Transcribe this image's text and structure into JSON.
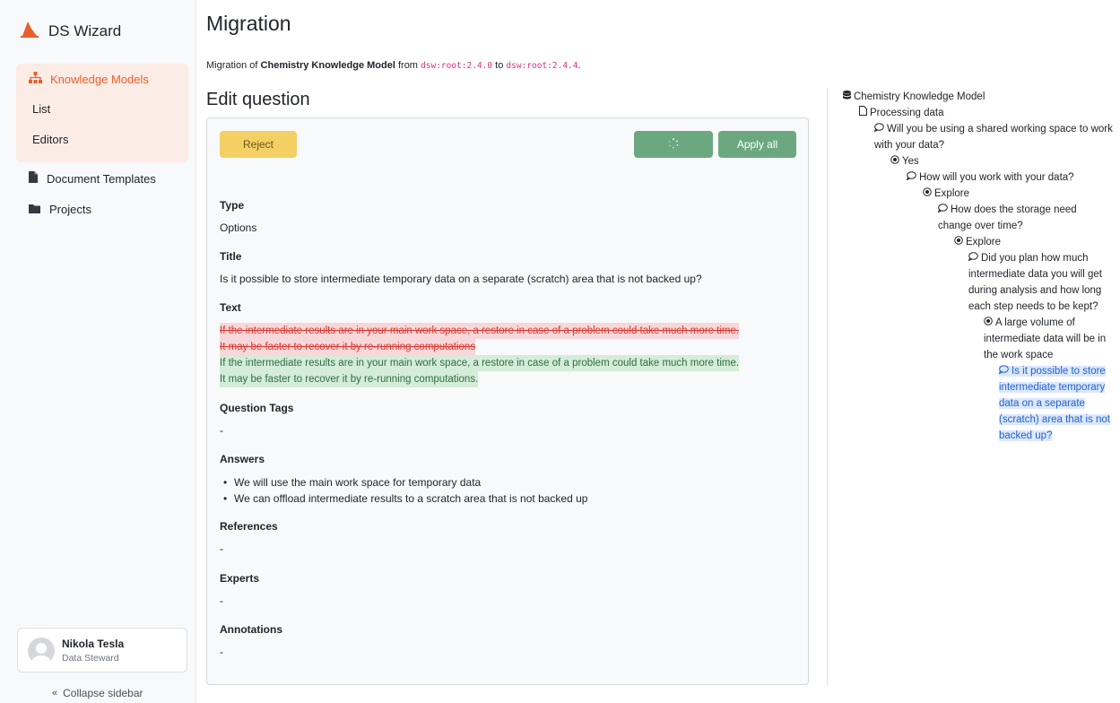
{
  "app": {
    "name": "DS Wizard"
  },
  "sidebar": {
    "knowledge_models": "Knowledge Models",
    "list": "List",
    "editors": "Editors",
    "document_templates": "Document Templates",
    "projects": "Projects",
    "collapse": "Collapse sidebar",
    "user": {
      "name": "Nikola Tesla",
      "role": "Data Steward"
    }
  },
  "page": {
    "title": "Migration",
    "migration_prefix": "Migration of",
    "km_name": "Chemistry Knowledge Model",
    "from_word": "from",
    "from_version": "dsw:root:2.4.0",
    "to_word": "to",
    "to_version": "dsw:root:2.4.4",
    "period": "."
  },
  "edit": {
    "heading": "Edit question",
    "reject_label": "Reject",
    "apply_all_label": "Apply all",
    "type_label": "Type",
    "type_value": "Options",
    "title_label": "Title",
    "title_value": "Is it possible to store intermediate temporary data on a separate (scratch) area that is not backed up?",
    "text_label": "Text",
    "text_old_1": "If the intermediate results are in your main work space, a restore in case of a problem could take much more time.",
    "text_old_2": "It may be faster to recover it by re-running computations",
    "text_new_1": "If the intermediate results are in your main work space, a restore in case of a problem could take much more time.",
    "text_new_2": "It may be faster to recover it by re-running computations.",
    "tags_label": "Question Tags",
    "tags_value": "-",
    "answers_label": "Answers",
    "answers": [
      "We will use the main work space for temporary data",
      "We can offload intermediate results to a scratch area that is not backed up"
    ],
    "references_label": "References",
    "references_value": "-",
    "experts_label": "Experts",
    "experts_value": "-",
    "annotations_label": "Annotations",
    "annotations_value": "-"
  },
  "tree": {
    "root": "Chemistry Knowledge Model",
    "chapter": "Processing data",
    "q1": "Will you be using a shared working space to work with your data?",
    "a1": "Yes",
    "q2": "How will you work with your data?",
    "a2": "Explore",
    "q3": "How does the storage need change over time?",
    "a3": "Explore",
    "q4": "Did you plan how much intermediate data you will get during analysis and how long each step needs to be kept?",
    "a4": "A large volume of intermediate data will be in the work space",
    "q5": "Is it possible to store intermediate temporary data on a separate (scratch) area that is not backed up?"
  },
  "colors": {
    "accent": "#e8602c",
    "success": "#6ba87f",
    "warning": "#f3cf64"
  },
  "icons": [
    "wizard-hat-icon",
    "sitemap-icon",
    "file-icon",
    "folder-icon",
    "chevrons-left-icon",
    "spinner-icon",
    "database-icon",
    "comment-icon",
    "radio-icon"
  ]
}
